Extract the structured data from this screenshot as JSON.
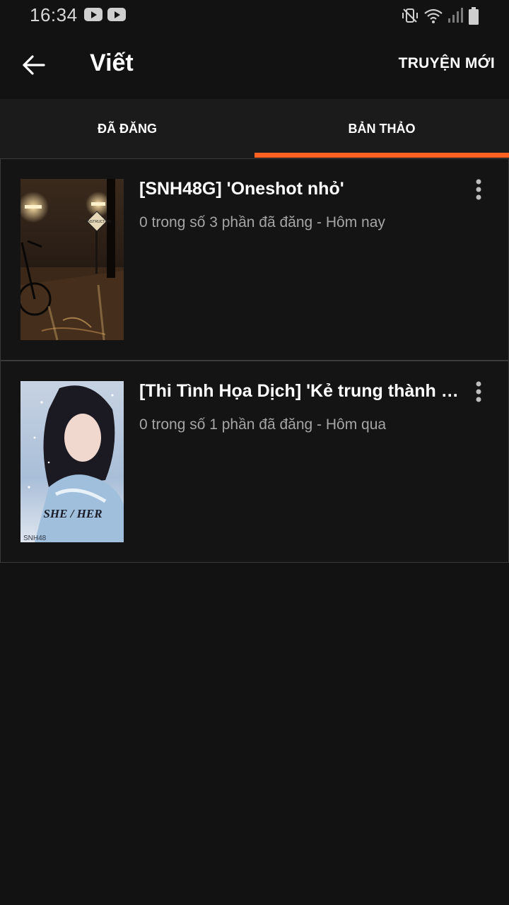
{
  "status_bar": {
    "time": "16:34",
    "icons": [
      "youtube-icon",
      "youtube-icon",
      "mute-vibrate-icon",
      "wifi-icon",
      "signal-icon",
      "battery-icon"
    ]
  },
  "app_bar": {
    "back_icon": "arrow-left",
    "title": "Viết",
    "new_story_label": "TRUYỆN MỚI"
  },
  "tabs": [
    {
      "label": "ĐÃ ĐĂNG",
      "selected": false
    },
    {
      "label": "BẢN THẢO",
      "selected": true
    }
  ],
  "accent_color": "#ff6122",
  "stories": [
    {
      "title": "[SNH48G] 'Oneshot nhỏ'",
      "meta": "0 trong số 3 phần đã đăng - Hôm nay",
      "cover_text": "CONSTRUCTION"
    },
    {
      "title": "[Thi Tình Họa Dịch] 'Kẻ trung thành vô ...",
      "meta": "0 trong số 1 phần đã đăng - Hôm qua",
      "cover_text": "SHE / HER",
      "cover_small_text": "SNH48"
    }
  ]
}
